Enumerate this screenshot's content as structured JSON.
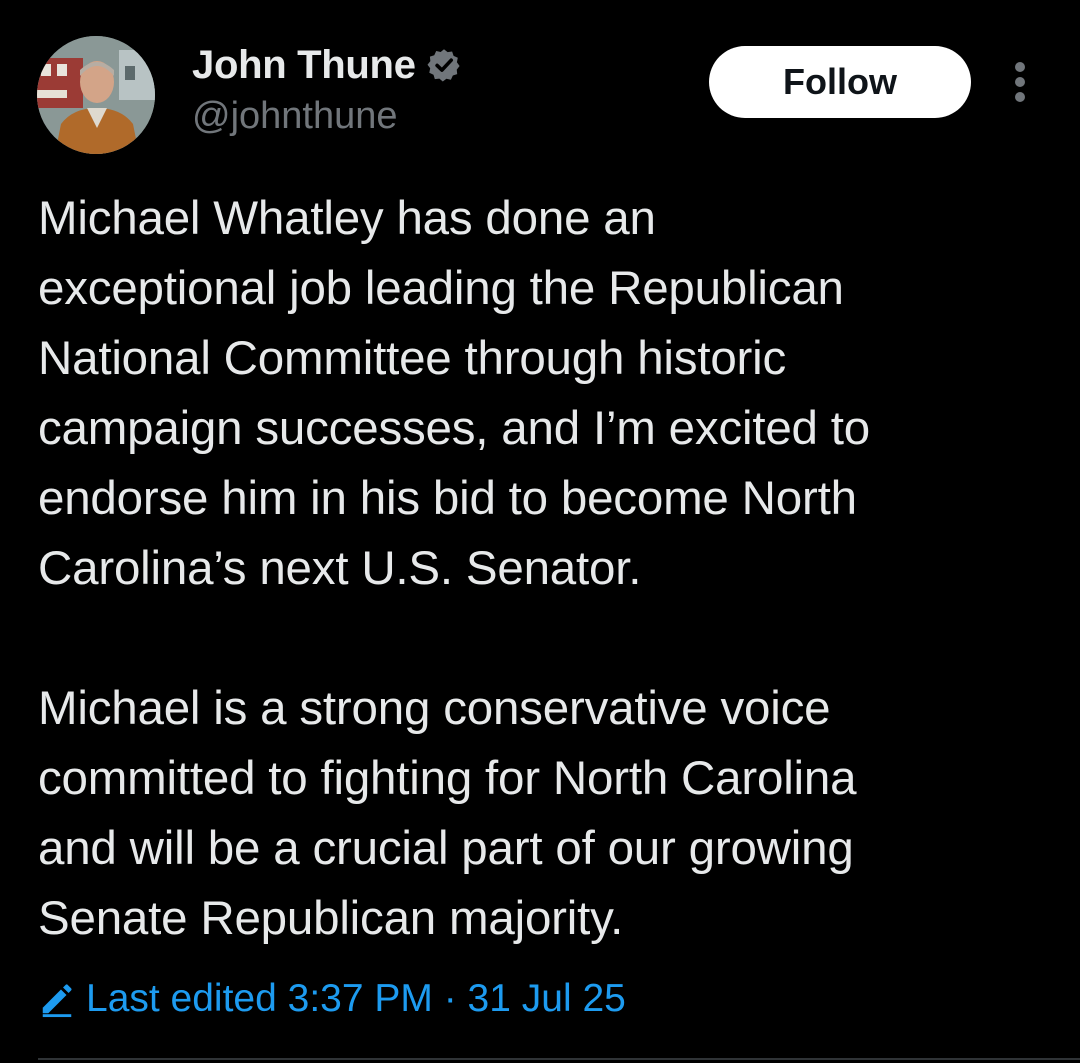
{
  "author": {
    "display_name": "John Thune",
    "handle": "@johnthune",
    "verified": true,
    "verified_color": "#71767b"
  },
  "actions": {
    "follow_label": "Follow",
    "more_icon": "more-vertical-icon"
  },
  "post": {
    "paragraph1_lines": [
      "Michael Whatley has done an",
      "exceptional job leading the Republican",
      "National Committee through historic",
      "campaign successes, and I’m excited to",
      "endorse him in his bid to become North",
      "Carolina’s next U.S. Senator."
    ],
    "paragraph2_lines": [
      "Michael is a strong conservative voice",
      "committed to fighting for North Carolina",
      "and will be a crucial part of our growing",
      "Senate Republican majority."
    ]
  },
  "edit_info": {
    "icon": "pencil-icon",
    "label": "Last edited 3:37 PM · 31 Jul 25"
  },
  "colors": {
    "background": "#000000",
    "text": "#e7e9ea",
    "secondary": "#71767b",
    "accent": "#1d9bf0",
    "follow_bg": "#ffffff"
  }
}
